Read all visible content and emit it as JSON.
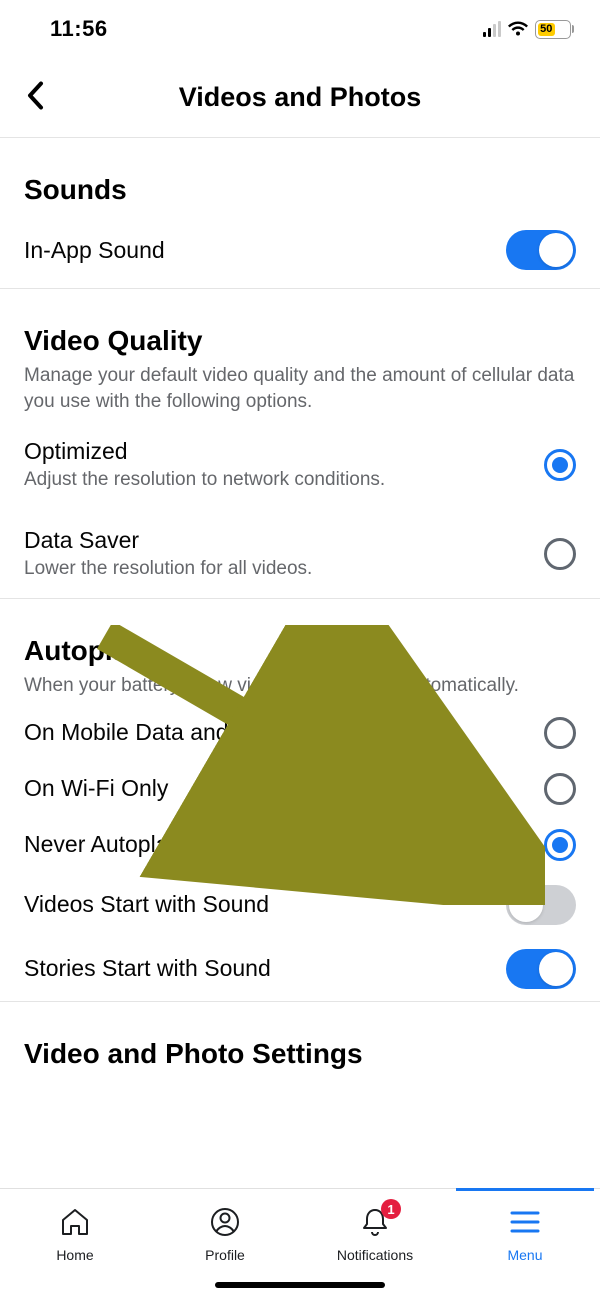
{
  "status_bar": {
    "time": "11:56",
    "battery_percent": "50"
  },
  "header": {
    "title": "Videos and Photos"
  },
  "sections": {
    "sounds": {
      "title": "Sounds",
      "in_app_sound": {
        "label": "In-App Sound",
        "on": true
      }
    },
    "video_quality": {
      "title": "Video Quality",
      "desc": "Manage your default video quality and the amount of cellular data you use with the following options.",
      "optimized": {
        "label": "Optimized",
        "sub": "Adjust the resolution to network conditions.",
        "selected": true
      },
      "data_saver": {
        "label": "Data Saver",
        "sub": "Lower the resolution for all videos.",
        "selected": false
      }
    },
    "autoplay": {
      "title": "Autoplay",
      "desc": "When your battery is low videos stop playing automatically.",
      "mobile_wifi": {
        "label": "On Mobile Data and Wi-Fi",
        "selected": false
      },
      "wifi_only": {
        "label": "On Wi-Fi Only",
        "selected": false
      },
      "never": {
        "label": "Never Autoplay Videos",
        "selected": true
      },
      "videos_sound": {
        "label": "Videos Start with Sound",
        "on": false
      },
      "stories_sound": {
        "label": "Stories Start with Sound",
        "on": true
      }
    },
    "video_photo_settings": {
      "title": "Video and Photo Settings"
    }
  },
  "tabs": {
    "home": "Home",
    "profile": "Profile",
    "notifications": "Notifications",
    "notifications_badge": "1",
    "menu": "Menu"
  },
  "colors": {
    "accent": "#1877f2",
    "annotation_arrow": "#8b8a1f"
  }
}
